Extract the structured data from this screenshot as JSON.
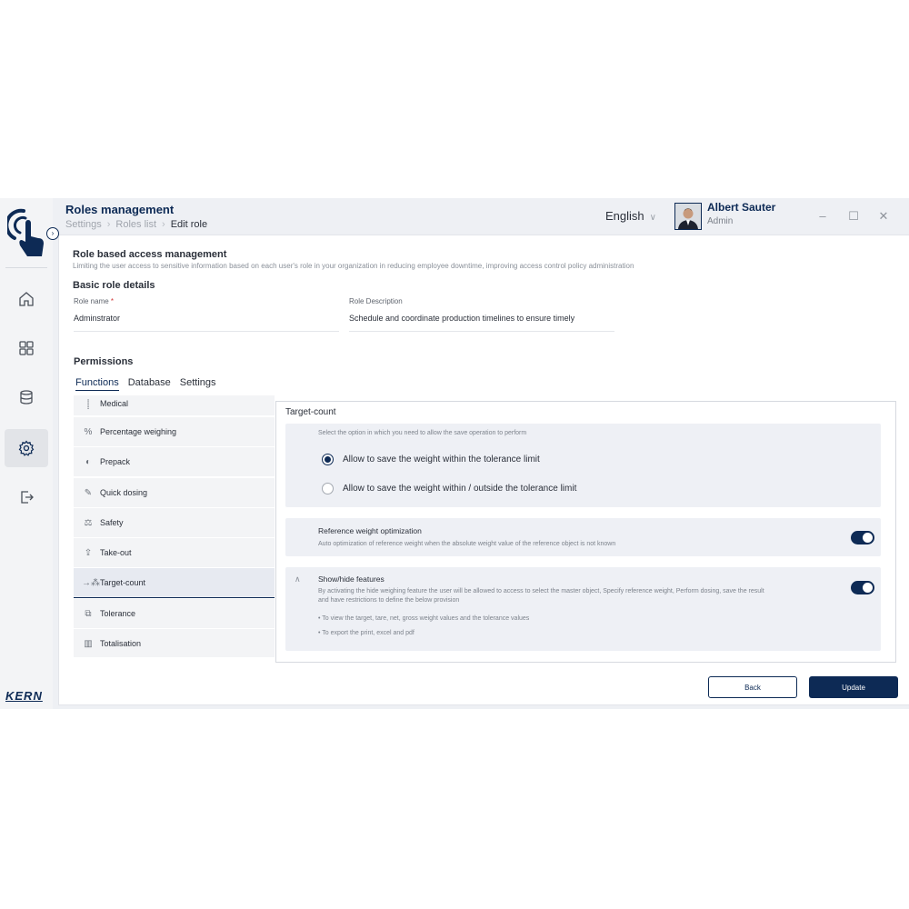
{
  "header": {
    "title": "Roles management",
    "breadcrumb": [
      "Settings",
      "Roles list",
      "Edit role"
    ],
    "language": "English",
    "user": {
      "name": "Albert Sauter",
      "role": "Admin"
    }
  },
  "brand": {
    "name": "KERN",
    "accent": "#0d2a55"
  },
  "window_controls": {
    "minimize": "–",
    "maximize": "☐",
    "close": "✕"
  },
  "page": {
    "title": "Role based access management",
    "subtitle": "Limiting the user access to sensitive information based on each user's role in your organization in reducing employee downtime, improving access control policy administration",
    "basic_title": "Basic role details",
    "role_name_label": "Role name",
    "required_mark": "*",
    "role_name_value": "Adminstrator",
    "role_desc_label": "Role Description",
    "role_desc_value": "Schedule and coordinate production timelines to ensure timely",
    "permissions_title": "Permissions"
  },
  "tabs": [
    "Functions",
    "Database",
    "Settings"
  ],
  "functions": [
    {
      "label": "Medical",
      "icon": "medical-icon",
      "glyph": "⸽"
    },
    {
      "label": "Percentage weighing",
      "icon": "percent-icon",
      "glyph": "%"
    },
    {
      "label": "Prepack",
      "icon": "prepack-icon",
      "glyph": "◐"
    },
    {
      "label": "Quick dosing",
      "icon": "dosing-icon",
      "glyph": "✎"
    },
    {
      "label": "Safety",
      "icon": "safety-icon",
      "glyph": "⚖"
    },
    {
      "label": "Take-out",
      "icon": "take-out-icon",
      "glyph": "⇪"
    },
    {
      "label": "Target-count",
      "icon": "target-count-icon",
      "glyph": "→⁂"
    },
    {
      "label": "Tolerance",
      "icon": "tolerance-icon",
      "glyph": "⧉"
    },
    {
      "label": "Totalisation",
      "icon": "totalisation-icon",
      "glyph": "▥"
    }
  ],
  "panel": {
    "title": "Target-count",
    "save_sub": "Select the option in which you need to allow the save operation to perform",
    "radio1": "Allow to save the weight within the tolerance limit",
    "radio2": "Allow to save the weight within / outside the tolerance limit",
    "ref_title": "Reference weight optimization",
    "ref_sub": "Auto optimization of reference weight when the absolute weight value of the reference object is not known",
    "show_title": "Show/hide features",
    "show_sub1": "By activating the hide weighing feature the user will be allowed to access to select the master object, Specify reference weight, Perform dosing, save the result",
    "show_sub2": "and have restrictions to define the below provision",
    "bullet1": "• To view the target, tare, net, gross weight values and the tolerance values",
    "bullet2": "• To export the print, excel and pdf"
  },
  "buttons": {
    "back": "Back",
    "update": "Update"
  }
}
